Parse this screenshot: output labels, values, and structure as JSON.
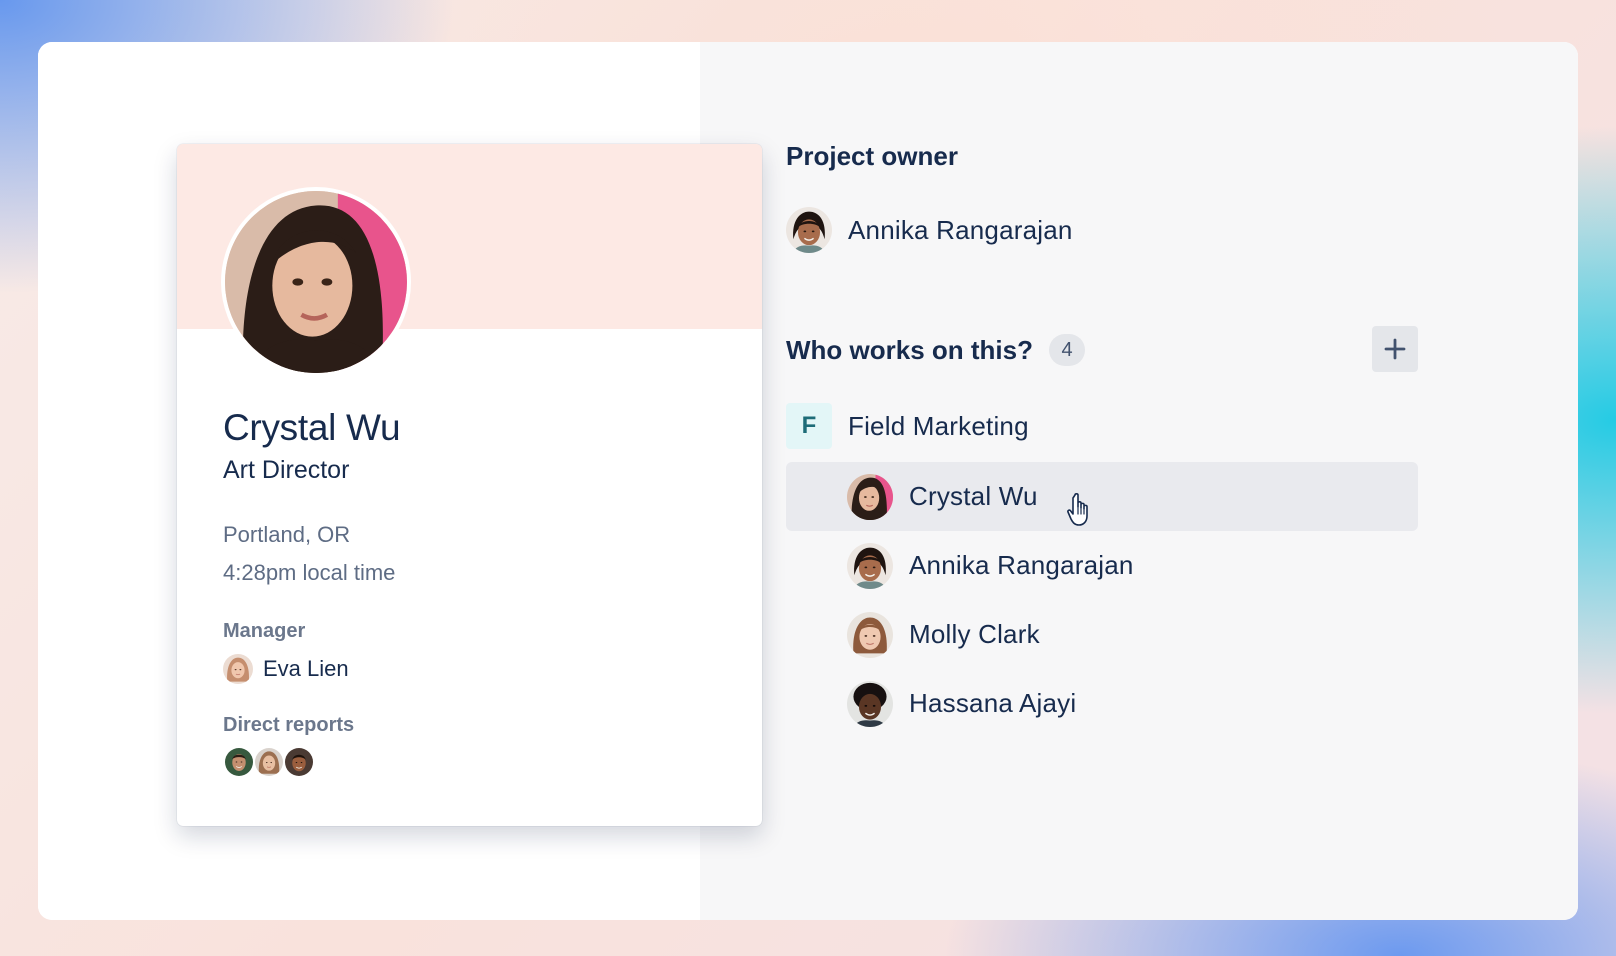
{
  "profile_card": {
    "name": "Crystal Wu",
    "role": "Art Director",
    "location": "Portland, OR",
    "local_time": "4:28pm local time",
    "manager_label": "Manager",
    "manager_name": "Eva Lien",
    "direct_reports_label": "Direct reports",
    "banner_color": "#fde9e4"
  },
  "project_owner": {
    "title": "Project owner",
    "name": "Annika Rangarajan"
  },
  "team_section": {
    "title": "Who works on this?",
    "count": "4",
    "add_icon": "plus-icon",
    "team": {
      "badge": "F",
      "name": "Field Marketing"
    },
    "members": [
      {
        "name": "Crystal Wu",
        "hovered": true
      },
      {
        "name": "Annika Rangarajan",
        "hovered": false
      },
      {
        "name": "Molly Clark",
        "hovered": false
      },
      {
        "name": "Hassana Ajayi",
        "hovered": false
      }
    ]
  },
  "colors": {
    "text_primary": "#172b4d",
    "text_secondary": "#5e6c84",
    "hover_row": "#e9eaee",
    "team_badge_bg": "#e3f6f7"
  }
}
